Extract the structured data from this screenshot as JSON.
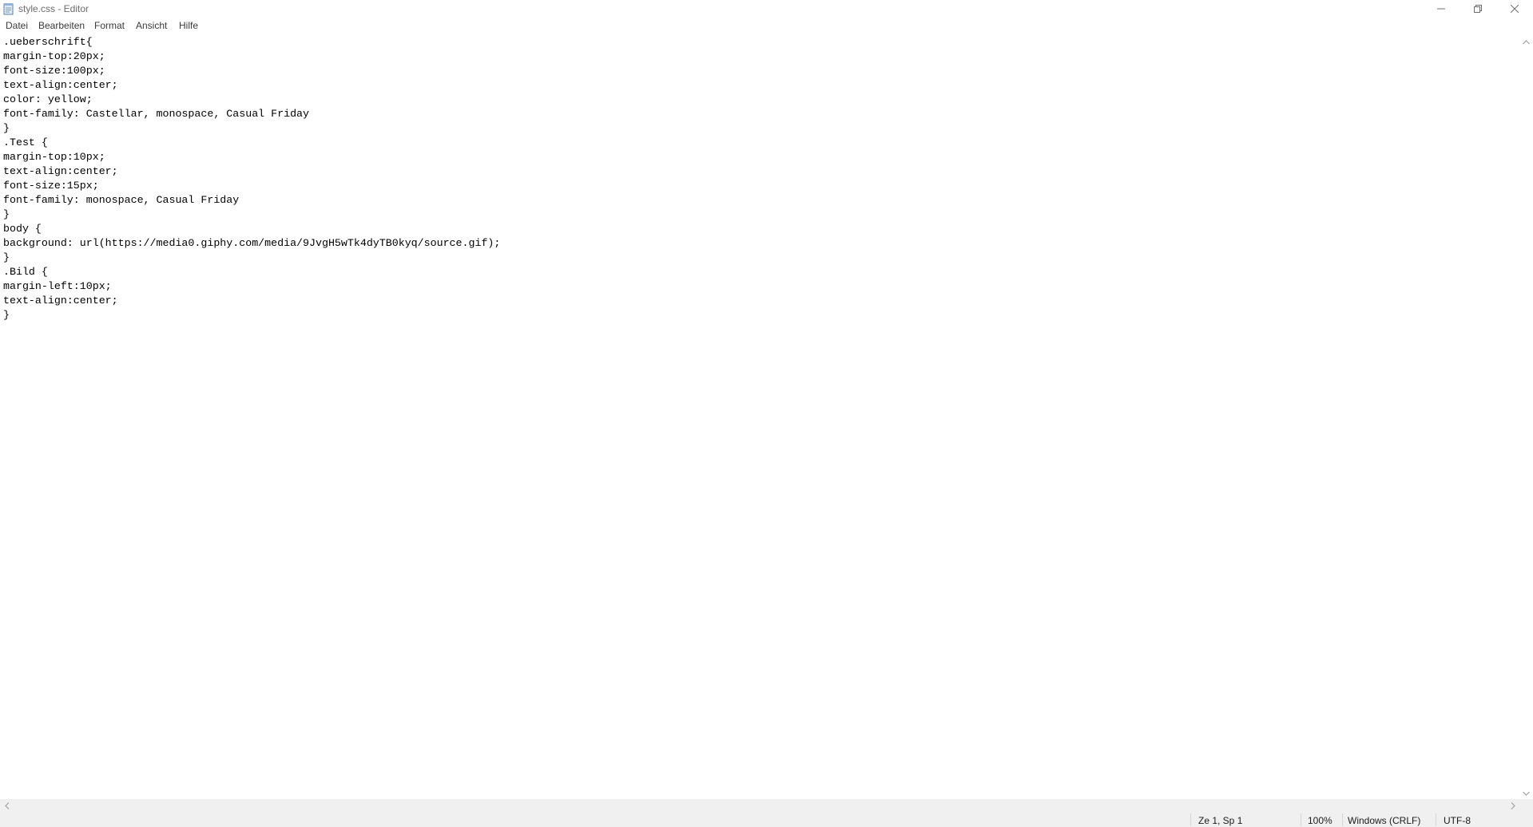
{
  "window": {
    "title": "style.css - Editor",
    "icons": {
      "app": "notepad-icon",
      "minimize": "minimize-icon",
      "maximize": "restore-icon",
      "close": "close-icon"
    }
  },
  "menubar": {
    "items": [
      {
        "label": "Datei"
      },
      {
        "label": "Bearbeiten"
      },
      {
        "label": "Format"
      },
      {
        "label": "Ansicht"
      },
      {
        "label": "Hilfe"
      }
    ]
  },
  "editor": {
    "lines": [
      ".ueberschrift{",
      "margin-top:20px;",
      "font-size:100px;",
      "text-align:center;",
      "color: yellow;",
      "font-family: Castellar, monospace, Casual Friday",
      "}",
      ".Test {",
      "margin-top:10px;",
      "text-align:center;",
      "font-size:15px;",
      "font-family: monospace, Casual Friday",
      "}",
      "body {",
      "background: url(https://media0.giphy.com/media/9JvgH5wTk4dyTB0kyq/source.gif);",
      "}",
      ".Bild {",
      "margin-left:10px;",
      "text-align:center;",
      "}"
    ]
  },
  "statusbar": {
    "position": "Ze 1, Sp 1",
    "zoom": "100%",
    "line_ending": "Windows (CRLF)",
    "encoding": "UTF-8"
  },
  "colors": {
    "text": "#000000",
    "chrome_text": "#6d6d6d",
    "statusbar_bg": "#f0f0f0"
  }
}
